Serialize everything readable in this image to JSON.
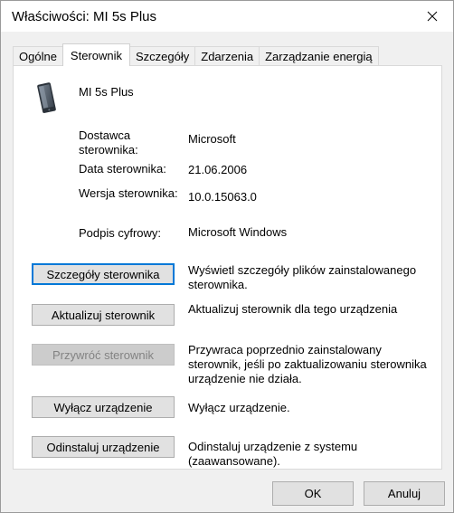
{
  "window": {
    "title": "Właściwości: MI 5s Plus"
  },
  "tabs": [
    {
      "label": "Ogólne"
    },
    {
      "label": "Sterownik"
    },
    {
      "label": "Szczegóły"
    },
    {
      "label": "Zdarzenia"
    },
    {
      "label": "Zarządzanie energią"
    }
  ],
  "active_tab": "Sterownik",
  "device": {
    "name": "MI 5s Plus",
    "icon": "phone-device-icon"
  },
  "driver_info": {
    "provider_label": "Dostawca sterownika:",
    "provider_value": "Microsoft",
    "date_label": "Data sterownika:",
    "date_value": "21.06.2006",
    "version_label": "Wersja sterownika:",
    "version_value": "10.0.15063.0",
    "signer_label": "Podpis cyfrowy:",
    "signer_value": "Microsoft Windows"
  },
  "actions": [
    {
      "button": "Szczegóły sterownika",
      "description": "Wyświetl szczegóły plików zainstalowanego sterownika.",
      "enabled": true
    },
    {
      "button": "Aktualizuj sterownik",
      "description": "Aktualizuj sterownik dla tego urządzenia",
      "enabled": true
    },
    {
      "button": "Przywróć sterownik",
      "description": "Przywraca poprzednio zainstalowany sterownik, jeśli po zaktualizowaniu sterownika urządzenie nie działa.",
      "enabled": false
    },
    {
      "button": "Wyłącz urządzenie",
      "description": "Wyłącz urządzenie.",
      "enabled": true
    },
    {
      "button": "Odinstaluj urządzenie",
      "description": "Odinstaluj urządzenie z systemu (zaawansowane).",
      "enabled": true
    }
  ],
  "footer": {
    "ok_label": "OK",
    "cancel_label": "Anuluj"
  },
  "colors": {
    "focus": "#0078d7",
    "button_bg": "#e1e1e1",
    "disabled_text": "#838383"
  }
}
